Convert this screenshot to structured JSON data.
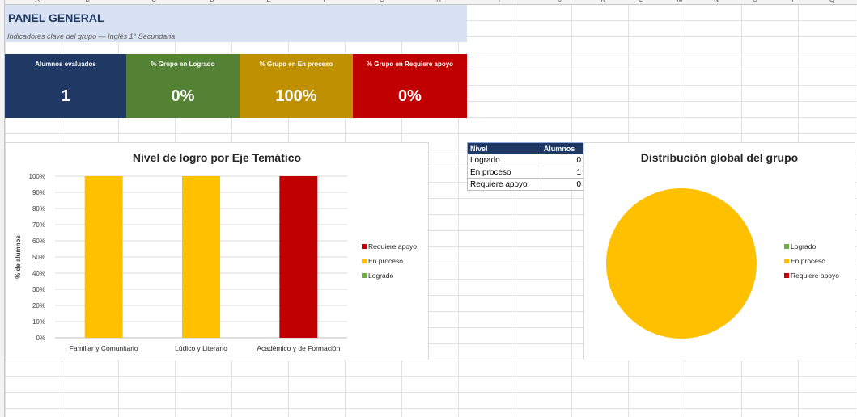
{
  "columns": [
    "A",
    "B",
    "C",
    "D",
    "E",
    "F",
    "G",
    "H",
    "I",
    "J",
    "K",
    "L",
    "M",
    "N",
    "O",
    "P",
    "Q"
  ],
  "header": {
    "title": "PANEL GENERAL",
    "subtitle": "Indicadores clave del grupo — Inglés 1° Secundaria"
  },
  "kpis": [
    {
      "label": "Alumnos evaluados",
      "value": "1",
      "color": "#1f3864"
    },
    {
      "label": "% Grupo en Logrado",
      "value": "0%",
      "color": "#548235"
    },
    {
      "label": "% Grupo en En proceso",
      "value": "100%",
      "color": "#bf9000"
    },
    {
      "label": "% Grupo en Requiere apoyo",
      "value": "0%",
      "color": "#c00000"
    }
  ],
  "summary_table": {
    "headers": [
      "Nivel",
      "Alumnos"
    ],
    "rows": [
      {
        "nivel": "Logrado",
        "alumnos": "0"
      },
      {
        "nivel": "En proceso",
        "alumnos": "1"
      },
      {
        "nivel": "Requiere apoyo",
        "alumnos": "0"
      }
    ]
  },
  "colors": {
    "logrado": "#70ad47",
    "en_proceso": "#ffc000",
    "requiere_apoyo": "#c00000"
  },
  "chart_data": [
    {
      "type": "bar",
      "title": "Nivel de logro por Eje Temático",
      "ylabel": "% de alumnos",
      "xlabel": "",
      "categories": [
        "Familiar y Comunitario",
        "Lúdico y Literario",
        "Académico y de Formación"
      ],
      "stacked": true,
      "ylim": [
        0,
        100
      ],
      "yticks": [
        "0%",
        "10%",
        "20%",
        "30%",
        "40%",
        "50%",
        "60%",
        "70%",
        "80%",
        "90%",
        "100%"
      ],
      "series": [
        {
          "name": "Logrado",
          "values": [
            0,
            0,
            0
          ],
          "color": "#70ad47"
        },
        {
          "name": "En proceso",
          "values": [
            100,
            100,
            0
          ],
          "color": "#ffc000"
        },
        {
          "name": "Requiere apoyo",
          "values": [
            0,
            0,
            100
          ],
          "color": "#c00000"
        }
      ],
      "legend_order": [
        "Requiere apoyo",
        "En proceso",
        "Logrado"
      ],
      "legend": "right",
      "grid": true
    },
    {
      "type": "pie",
      "title": "Distribución global del grupo",
      "labels": [
        "Logrado",
        "En proceso",
        "Requiere apoyo"
      ],
      "values": [
        0,
        1,
        0
      ],
      "colors": [
        "#70ad47",
        "#ffc000",
        "#c00000"
      ],
      "legend": "right"
    }
  ]
}
